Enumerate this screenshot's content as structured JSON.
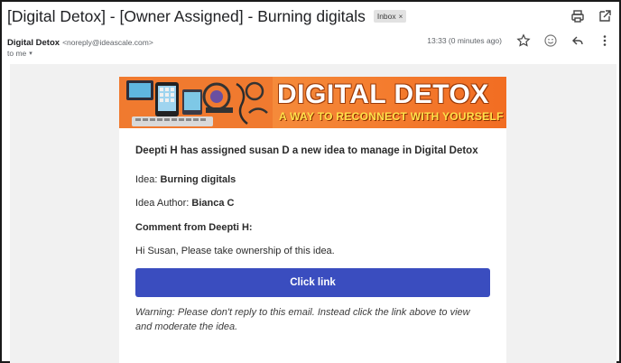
{
  "subject": {
    "text": "[Digital Detox] - [Owner Assigned] - Burning digitals",
    "label_chip": "Inbox",
    "label_chip_close": "×"
  },
  "sender": {
    "name": "Digital Detox",
    "email": "<noreply@ideascale.com>",
    "timestamp": "13:33 (0 minutes ago)",
    "to": "to me",
    "to_caret": "▾"
  },
  "banner": {
    "title": "DIGITAL DETOX",
    "tagline": "A WAY TO RECONNECT WITH YOURSELF"
  },
  "body": {
    "headline": "Deepti H has assigned susan D a new idea to manage in Digital Detox",
    "idea_label": "Idea: ",
    "idea_value": "Burning digitals",
    "author_label": "Idea Author: ",
    "author_value": "Bianca C",
    "comment_heading": "Comment from Deepti H:",
    "comment_text": "Hi Susan, Please take ownership of this idea.",
    "cta_label": "Click link",
    "warning": "Warning: Please don't reply to this email. Instead click the link above to view and moderate the idea."
  },
  "colors": {
    "cta": "#3a4dbf",
    "banner": "#f0772b",
    "body_bg": "#f1f1f1"
  },
  "icons": [
    "print-icon",
    "open-new-window-icon",
    "star-icon",
    "emoji-icon",
    "reply-icon",
    "more-vert-icon"
  ]
}
